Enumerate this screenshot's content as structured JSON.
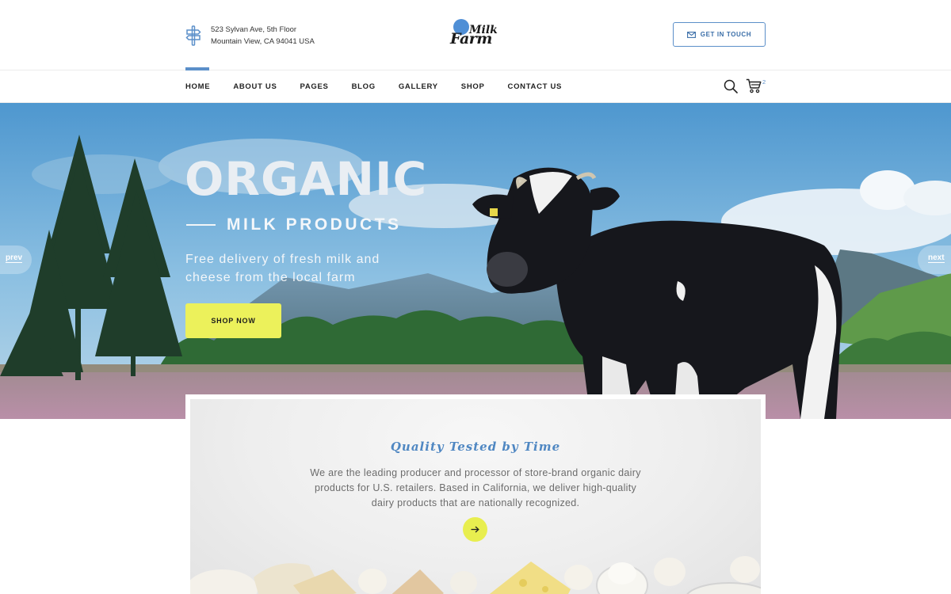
{
  "header": {
    "address_line1": "523 Sylvan Ave, 5th Floor",
    "address_line2": "Mountain View, CA 94041 USA",
    "logo_milk": "Milk",
    "logo_farm": "Farm",
    "contact_button": "GET IN TOUCH"
  },
  "nav": {
    "items": [
      {
        "label": "HOME",
        "active": true
      },
      {
        "label": "ABOUT US"
      },
      {
        "label": "PAGES"
      },
      {
        "label": "BLOG"
      },
      {
        "label": "GALLERY"
      },
      {
        "label": "SHOP"
      },
      {
        "label": "CONTACT US"
      }
    ],
    "cart_count": "2",
    "icons": [
      "search-icon",
      "cart-icon"
    ]
  },
  "hero": {
    "title": "ORGANIC",
    "subtitle": "MILK PRODUCTS",
    "description": "Free delivery of fresh milk and cheese from the local farm",
    "button": "SHOP NOW",
    "prev": "prev",
    "next": "next"
  },
  "feature": {
    "title": "Quality Tested by Time",
    "text": "We are the leading producer and processor of store-brand organic dairy products for U.S. retailers. Based in California, we deliver high-quality dairy products that are nationally recognized."
  },
  "colors": {
    "accent_blue": "#5b8fc9",
    "button_yellow": "#ecf15b",
    "text_dark": "#222222"
  }
}
